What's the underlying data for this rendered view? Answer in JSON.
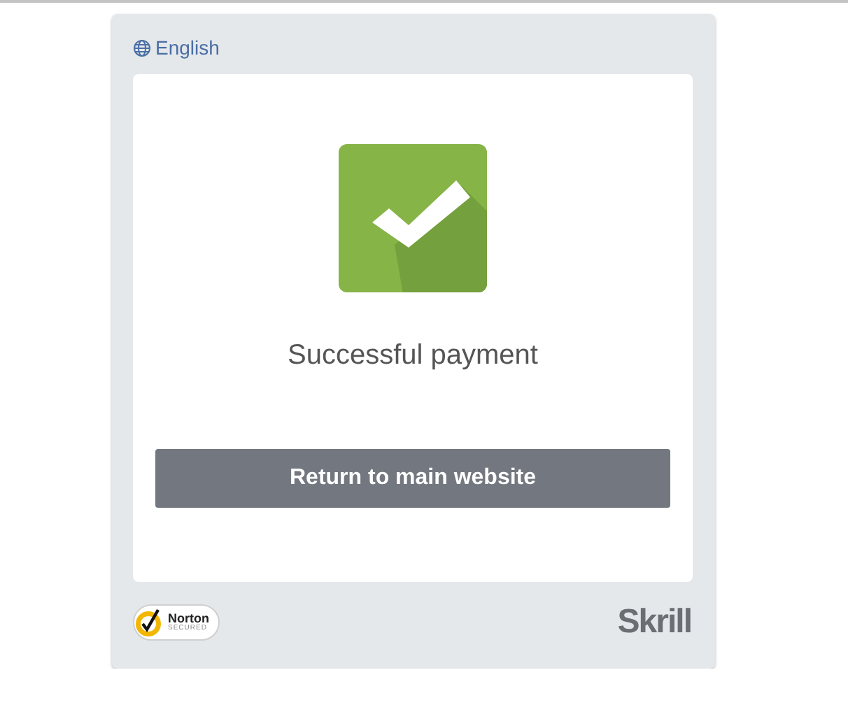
{
  "language": {
    "label": "English"
  },
  "status": {
    "kind": "success",
    "message": "Successful payment"
  },
  "button": {
    "label": "Return to main website"
  },
  "footer": {
    "badge": {
      "name": "Norton",
      "caption": "SECURED"
    },
    "brand": "Skrill"
  }
}
